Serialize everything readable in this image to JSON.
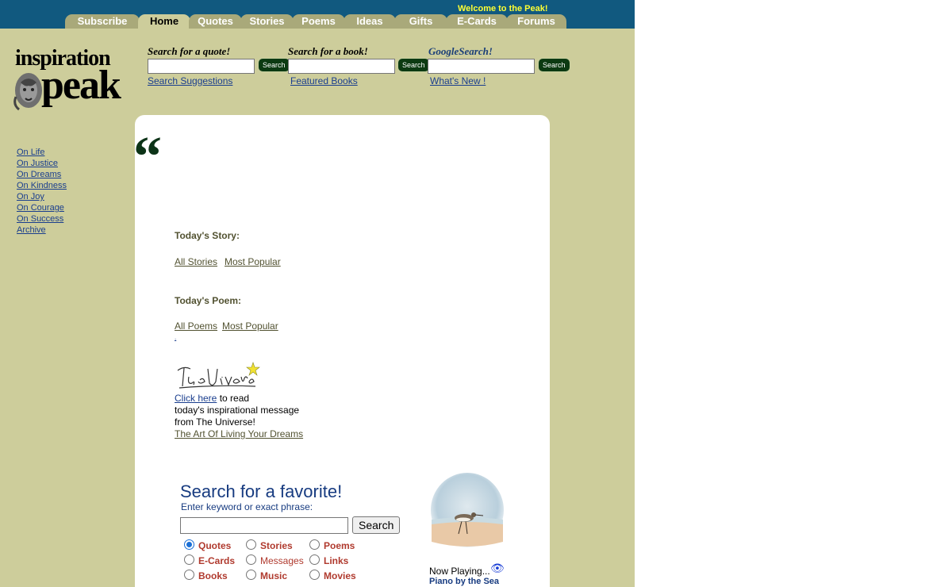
{
  "header": {
    "welcome": "Welcome to the Peak!",
    "tabs": [
      "Subscribe",
      "Home",
      "Quotes",
      "Stories",
      "Poems",
      "Ideas",
      "Gifts",
      "E-Cards",
      "Forums"
    ],
    "active_tab": "Home"
  },
  "logo": {
    "line1": "inspiration",
    "line2": "peak"
  },
  "search": [
    {
      "heading": "Search for a quote!",
      "button": "Search",
      "link": "Search Suggestions"
    },
    {
      "heading": "Search for a book!",
      "button": "Search",
      "link": "Featured Books"
    },
    {
      "heading": "GoogleSearch!",
      "button": "Search",
      "link": "What's New !"
    }
  ],
  "left_nav": [
    "On Life",
    "On Justice",
    "On Dreams",
    "On Kindness",
    "On Joy",
    "On Courage",
    "On Success",
    "Archive"
  ],
  "main": {
    "quote_mark": "“",
    "story": {
      "heading": "Today's Story:",
      "links": [
        "All Stories ",
        "Most Popular"
      ]
    },
    "poem": {
      "heading": "Today's Poem:",
      "links": [
        "All Poems",
        "Most Popular"
      ]
    },
    "dot_link": ".",
    "universe": {
      "signature": "The Universe",
      "click_here": "Click here",
      "line1_rest": " to read",
      "line2": "today's inspirational message",
      "line3": "from The Universe!",
      "art_link": "The Art Of Living Your Dreams"
    },
    "favorite": {
      "title": "Search for a favorite!",
      "subtitle": "Enter keyword or exact phrase:",
      "button": "Search",
      "options": [
        {
          "label": "Quotes",
          "checked": true
        },
        {
          "label": "Stories",
          "checked": false
        },
        {
          "label": "Poems",
          "checked": false
        },
        {
          "label": "E-Cards",
          "checked": false
        },
        {
          "label": "Messages",
          "checked": false
        },
        {
          "label": "Links",
          "checked": false
        },
        {
          "label": "Books",
          "checked": false
        },
        {
          "label": "Music",
          "checked": false
        },
        {
          "label": "Movies",
          "checked": false
        }
      ]
    },
    "music": {
      "now_playing": "Now Playing...",
      "track": "Piano by the Sea"
    }
  },
  "colors": {
    "site_bg": "#cdcd9b",
    "header_bg": "#11597f",
    "tab_bg": "#a9a97a",
    "welcome_text": "#ffff33",
    "link_blue": "#1a3e8e",
    "olive_text": "#525231",
    "option_red": "#b03a2e",
    "search_button_green": "#0c3a12"
  }
}
